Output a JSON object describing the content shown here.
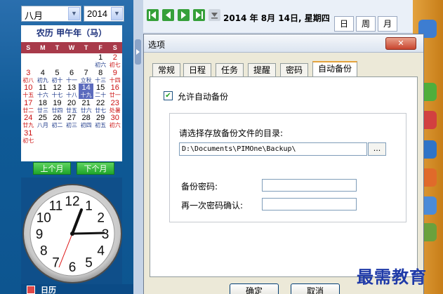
{
  "calendar": {
    "month": "八月",
    "year": "2014",
    "lunar_header": "农历  甲午年（马）",
    "weekday_headers": [
      "S",
      "M",
      "T",
      "W",
      "T",
      "F",
      "S"
    ],
    "weeks": [
      [
        {
          "d": "",
          "l": ""
        },
        {
          "d": "",
          "l": ""
        },
        {
          "d": "",
          "l": ""
        },
        {
          "d": "",
          "l": ""
        },
        {
          "d": "",
          "l": ""
        },
        {
          "d": "1",
          "l": "初六"
        },
        {
          "d": "2",
          "l": "初七"
        }
      ],
      [
        {
          "d": "3",
          "l": "初八"
        },
        {
          "d": "4",
          "l": "初九"
        },
        {
          "d": "5",
          "l": "初十"
        },
        {
          "d": "6",
          "l": "十一"
        },
        {
          "d": "7",
          "l": "立秋"
        },
        {
          "d": "8",
          "l": "十三"
        },
        {
          "d": "9",
          "l": "十四"
        }
      ],
      [
        {
          "d": "10",
          "l": "十五"
        },
        {
          "d": "11",
          "l": "十六"
        },
        {
          "d": "12",
          "l": "十七"
        },
        {
          "d": "13",
          "l": "十八"
        },
        {
          "d": "14",
          "l": "十九"
        },
        {
          "d": "15",
          "l": "二十"
        },
        {
          "d": "16",
          "l": "廿一"
        }
      ],
      [
        {
          "d": "17",
          "l": "廿二"
        },
        {
          "d": "18",
          "l": "廿三"
        },
        {
          "d": "19",
          "l": "廿四"
        },
        {
          "d": "20",
          "l": "廿五"
        },
        {
          "d": "21",
          "l": "廿六"
        },
        {
          "d": "22",
          "l": "廿七"
        },
        {
          "d": "23",
          "l": "处暑"
        }
      ],
      [
        {
          "d": "24",
          "l": "廿九"
        },
        {
          "d": "25",
          "l": "八月"
        },
        {
          "d": "26",
          "l": "初二"
        },
        {
          "d": "27",
          "l": "初三"
        },
        {
          "d": "28",
          "l": "初四"
        },
        {
          "d": "29",
          "l": "初五"
        },
        {
          "d": "30",
          "l": "初六"
        }
      ],
      [
        {
          "d": "31",
          "l": "初七"
        },
        {
          "d": "",
          "l": ""
        },
        {
          "d": "",
          "l": ""
        },
        {
          "d": "",
          "l": ""
        },
        {
          "d": "",
          "l": ""
        },
        {
          "d": "",
          "l": ""
        },
        {
          "d": "",
          "l": ""
        }
      ]
    ],
    "today": "14",
    "prev_month_label": "上个月",
    "next_month_label": "下个月",
    "clock_numbers": [
      "12",
      "1",
      "2",
      "3",
      "4",
      "5",
      "6",
      "7",
      "8",
      "9",
      "10",
      "11"
    ],
    "bottom_label": "日历"
  },
  "toolbar": {
    "date_label": "2014 年 8月 14日, 星期四",
    "view_tabs": [
      "日",
      "周",
      "月"
    ]
  },
  "dialog": {
    "title": "选项",
    "tabs": [
      "常规",
      "日程",
      "任务",
      "提醒",
      "密码",
      "自动备份"
    ],
    "active_tab": "自动备份",
    "auto_backup_label": "允许自动备份",
    "auto_backup_checked": true,
    "dir_label": "请选择存放备份文件的目录:",
    "dir_value": "D:\\Documents\\PIMOne\\Backup\\",
    "browse_label": "...",
    "password_label": "备份密码:",
    "confirm_label": "再一次密码确认:",
    "ok_label": "确定",
    "cancel_label": "取消"
  },
  "watermark": "最需教育",
  "colors": {
    "accent": "#0f5a96",
    "calendar_header": "#a83a4a",
    "today": "#5b6bbd",
    "weekend": "#cc1010"
  }
}
